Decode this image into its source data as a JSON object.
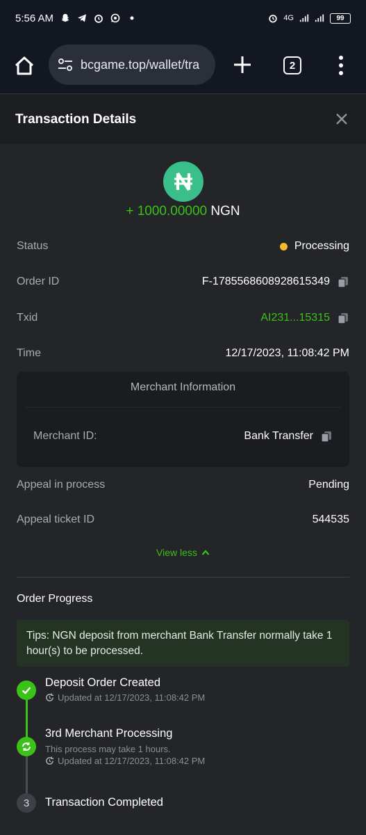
{
  "status_bar": {
    "time": "5:56 AM",
    "network": "4G",
    "battery": "99"
  },
  "browser": {
    "url": "bcgame.top/wallet/tra",
    "tab_count": "2"
  },
  "modal": {
    "title": "Transaction Details"
  },
  "amount": {
    "sign_value": "+ 1000.00000",
    "currency": "NGN",
    "coin_symbol": "₦"
  },
  "details": {
    "status_label": "Status",
    "status_value": "Processing",
    "order_id_label": "Order ID",
    "order_id_value": "F-1785568608928615349",
    "txid_label": "Txid",
    "txid_value": "AI231...15315",
    "time_label": "Time",
    "time_value": "12/17/2023, 11:08:42 PM"
  },
  "merchant": {
    "title": "Merchant Information",
    "id_label": "Merchant ID:",
    "id_value": "Bank Transfer"
  },
  "appeal": {
    "process_label": "Appeal in process",
    "process_value": "Pending",
    "ticket_label": "Appeal ticket ID",
    "ticket_value": "544535"
  },
  "view_less_label": "View less",
  "progress": {
    "title": "Order Progress",
    "tips": "Tips: NGN deposit from merchant Bank Transfer normally take 1 hour(s) to be processed.",
    "steps": [
      {
        "title": "Deposit Order Created",
        "updated": "Updated at 12/17/2023, 11:08:42 PM"
      },
      {
        "title": "3rd Merchant Processing",
        "note": "This process may take 1 hours.",
        "updated": "Updated at 12/17/2023, 11:08:42 PM"
      },
      {
        "title": "Transaction Completed",
        "number": "3"
      }
    ]
  },
  "colors": {
    "accent_green": "#3bc117",
    "status_pending": "#f5b92d",
    "coin_bg": "#3bbf8a"
  }
}
